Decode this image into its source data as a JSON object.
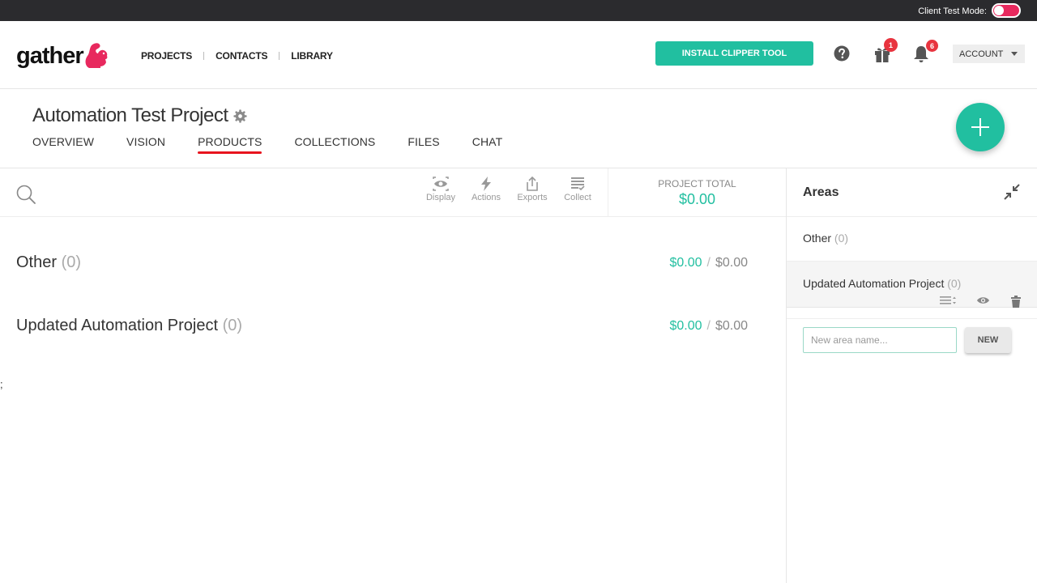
{
  "topbar": {
    "client_test_mode_label": "Client Test Mode:",
    "client_test_mode_on": true
  },
  "brand": {
    "logo_text": "gather",
    "accent": "#e8295e"
  },
  "nav": {
    "items": [
      "PROJECTS",
      "CONTACTS",
      "LIBRARY"
    ]
  },
  "header": {
    "install_clipper_label": "INSTALL CLIPPER TOOL",
    "gift_badge": "1",
    "notifications_badge": "6",
    "account_label": "ACCOUNT"
  },
  "project": {
    "title": "Automation Test Project",
    "tabs": [
      "OVERVIEW",
      "VISION",
      "PRODUCTS",
      "COLLECTIONS",
      "FILES",
      "CHAT"
    ],
    "active_tab": "PRODUCTS"
  },
  "toolbar": {
    "tools": [
      "Display",
      "Actions",
      "Exports",
      "Collect"
    ],
    "project_total_label": "PROJECT TOTAL",
    "project_total_value": "$0.00"
  },
  "areas_list": [
    {
      "name": "Other",
      "count": "(0)",
      "amount": "$0.00",
      "budget": "$0.00"
    },
    {
      "name": "Updated Automation Project",
      "count": "(0)",
      "amount": "$0.00",
      "budget": "$0.00"
    }
  ],
  "stray_text": ";",
  "panel": {
    "title": "Areas",
    "items": [
      {
        "name": "Other",
        "count": "(0)"
      },
      {
        "name": "Updated Automation Project",
        "count": "(0)"
      }
    ],
    "new_area_placeholder": "New area name...",
    "new_button_label": "NEW"
  },
  "colors": {
    "teal": "#21bfa0",
    "active_tab_underline": "#e8141e",
    "badge": "#e8343f",
    "topbar": "#2b2b2e"
  }
}
